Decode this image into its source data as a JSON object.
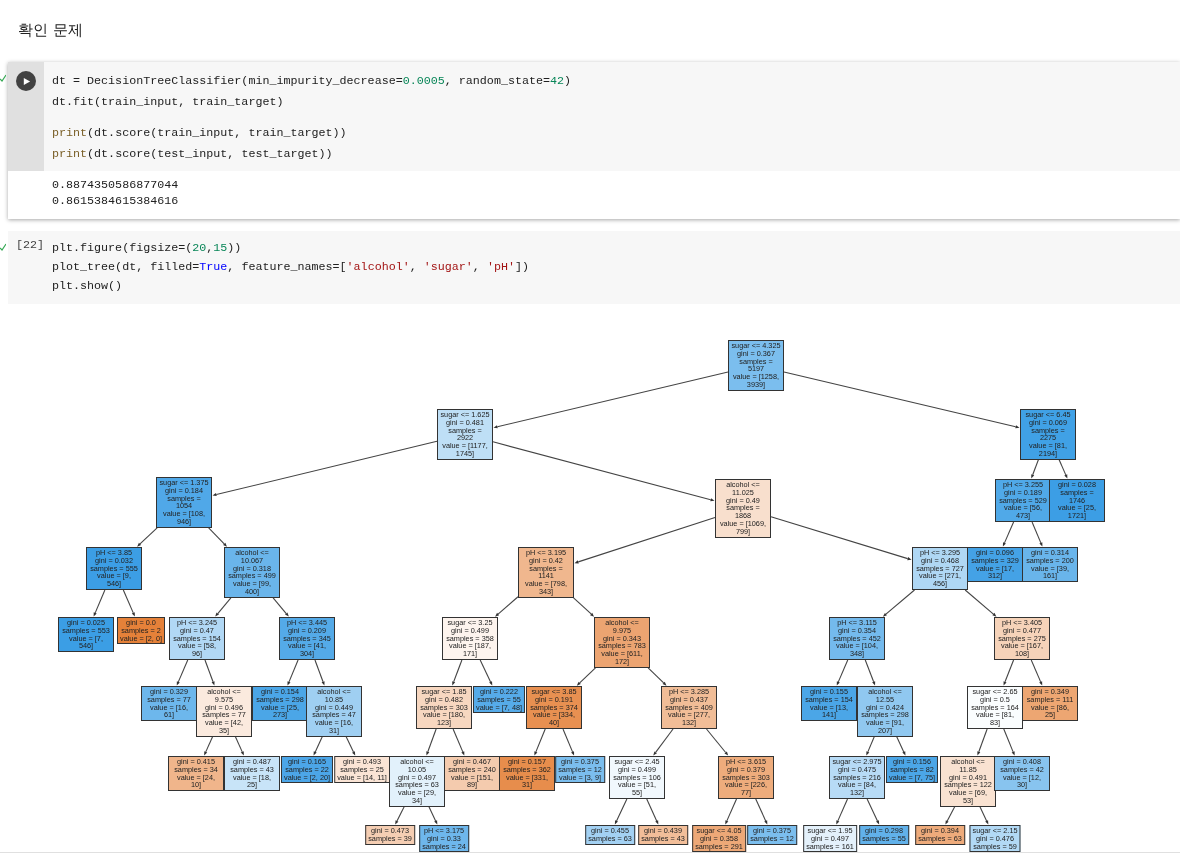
{
  "heading": "확인 문제",
  "cells": [
    {
      "focused": true,
      "completed": true,
      "code": [
        [
          [
            {
              "t": "dt = DecisionTreeClassifier(min_impurity_decrease=",
              "kind": "plain"
            },
            {
              "t": "0.0005",
              "kind": "num"
            },
            {
              "t": ", random_state=",
              "kind": "plain"
            },
            {
              "t": "42",
              "kind": "num"
            },
            {
              "t": ")",
              "kind": "plain"
            }
          ],
          [
            {
              "t": "dt.fit(train_input, train_target)",
              "kind": "plain"
            }
          ]
        ],
        [
          [
            {
              "t": "print",
              "kind": "fn"
            },
            {
              "t": "(dt.score(train_input, train_target))",
              "kind": "plain"
            }
          ],
          [
            {
              "t": "print",
              "kind": "fn"
            },
            {
              "t": "(dt.score(test_input, test_target))",
              "kind": "plain"
            }
          ]
        ]
      ],
      "output": [
        "0.8874350586877044",
        "0.8615384615384616"
      ]
    },
    {
      "focused": false,
      "completed": true,
      "execution_count": "[22]",
      "code": [
        [
          [
            {
              "t": "plt.figure(figsize=(",
              "kind": "plain"
            },
            {
              "t": "20",
              "kind": "num"
            },
            {
              "t": ",",
              "kind": "plain"
            },
            {
              "t": "15",
              "kind": "num"
            },
            {
              "t": "))",
              "kind": "plain"
            }
          ],
          [
            {
              "t": "plot_tree(dt, filled=",
              "kind": "plain"
            },
            {
              "t": "True",
              "kind": "kw"
            },
            {
              "t": ", feature_names=[",
              "kind": "plain"
            },
            {
              "t": "'alcohol'",
              "kind": "str"
            },
            {
              "t": ", ",
              "kind": "plain"
            },
            {
              "t": "'sugar'",
              "kind": "str"
            },
            {
              "t": ", ",
              "kind": "plain"
            },
            {
              "t": "'pH'",
              "kind": "str"
            },
            {
              "t": "])",
              "kind": "plain"
            }
          ],
          [
            {
              "t": "plt.show()",
              "kind": "plain"
            }
          ]
        ]
      ],
      "tree": {
        "lines": [
          "sugar <= 4.325",
          "gini = 0.367",
          "samples = 5197",
          "value = [1258, 3939]"
        ],
        "color": "#7bbeee",
        "children": [
          {
            "lines": [
              "sugar <= 1.625",
              "gini = 0.481",
              "samples = 2922",
              "value = [1177, 1745]"
            ],
            "color": "#bedff6",
            "children": [
              {
                "lines": [
                  "sugar <= 1.375",
                  "gini = 0.184",
                  "samples = 1054",
                  "value = [108, 946]"
                ],
                "color": "#50a8e8",
                "children": [
                  {
                    "lines": [
                      "pH <= 3.85",
                      "gini = 0.032",
                      "samples = 555",
                      "value = [9, 546]"
                    ],
                    "color": "#3c9ee5",
                    "children": [
                      {
                        "lines": [
                          "gini = 0.025",
                          "samples = 553",
                          "value = [7, 546]"
                        ],
                        "color": "#3b9ee5"
                      },
                      {
                        "lines": [
                          "gini = 0.0",
                          "samples = 2",
                          "value = [2, 0]"
                        ],
                        "color": "#e58139"
                      }
                    ]
                  },
                  {
                    "lines": [
                      "alcohol <= 10.067",
                      "gini = 0.318",
                      "samples = 499",
                      "value = [99, 400]"
                    ],
                    "color": "#6ab5eb",
                    "children": [
                      {
                        "lines": [
                          "pH <= 3.245",
                          "gini = 0.47",
                          "samples = 154",
                          "value = [58, 96]"
                        ],
                        "color": "#b1d8f5",
                        "children": [
                          {
                            "lines": [
                              "gini = 0.329",
                              "samples = 77",
                              "value = [16, 61]"
                            ],
                            "color": "#6db7ec"
                          },
                          {
                            "lines": [
                              "alcohol <= 9.575",
                              "gini = 0.496",
                              "samples = 77",
                              "value = [42, 35]"
                            ],
                            "color": "#fbeade",
                            "children": [
                              {
                                "lines": [
                                  "gini = 0.415",
                                  "samples = 34",
                                  "value = [24, 10]"
                                ],
                                "color": "#f0b58b"
                              },
                              {
                                "lines": [
                                  "gini = 0.487",
                                  "samples = 43",
                                  "value = [18, 25]"
                                ],
                                "color": "#c8e4f8"
                              }
                            ]
                          }
                        ]
                      },
                      {
                        "lines": [
                          "pH <= 3.445",
                          "gini = 0.209",
                          "samples = 345",
                          "value = [41, 304]"
                        ],
                        "color": "#54aae8",
                        "children": [
                          {
                            "lines": [
                              "gini = 0.154",
                              "samples = 298",
                              "value = [25, 273]"
                            ],
                            "color": "#4ba6e7"
                          },
                          {
                            "lines": [
                              "alcohol <= 10.85",
                              "gini = 0.449",
                              "samples = 47",
                              "value = [16, 31]"
                            ],
                            "color": "#9fcff2",
                            "children": [
                              {
                                "lines": [
                                  "gini = 0.165",
                                  "samples = 22",
                                  "value = [2, 20]"
                                ],
                                "color": "#4ca6e8"
                              },
                              {
                                "lines": [
                                  "gini = 0.493",
                                  "samples = 25",
                                  "value = [14, 11]"
                                ],
                                "color": "#fae4d5"
                              }
                            ]
                          }
                        ]
                      }
                    ]
                  }
                ]
              },
              {
                "lines": [
                  "alcohol <= 11.025",
                  "gini = 0.49",
                  "samples = 1868",
                  "value = [1069, 799]"
                ],
                "color": "#f8dfcd",
                "children": [
                  {
                    "lines": [
                      "pH <= 3.195",
                      "gini = 0.42",
                      "samples = 1141",
                      "value = [798, 343]"
                    ],
                    "color": "#f0b78e",
                    "children": [
                      {
                        "lines": [
                          "sugar <= 3.25",
                          "gini = 0.499",
                          "samples = 358",
                          "value = [187, 171]"
                        ],
                        "color": "#fdf4ee",
                        "children": [
                          {
                            "lines": [
                              "sugar <= 1.85",
                              "gini = 0.482",
                              "samples = 303",
                              "value = [180, 123]"
                            ],
                            "color": "#f7d7c0",
                            "children": [
                              {
                                "lines": [
                                  "alcohol <= 10.05",
                                  "gini = 0.497",
                                  "samples = 63",
                                  "value = [29, 34]"
                                ],
                                "color": "#e2f1fb",
                                "children": [
                                  {
                                    "lines": [
                                      "gini = 0.473",
                                      "samples = 39"
                                    ],
                                    "color": "#f5ceb3"
                                  },
                                  {
                                    "lines": [
                                      "pH <= 3.175",
                                      "gini = 0.33",
                                      "samples = 24"
                                    ],
                                    "color": "#6eb7ec"
                                  }
                                ]
                              },
                              {
                                "lines": [
                                  "gini = 0.467",
                                  "samples = 240",
                                  "value = [151, 89]"
                                ],
                                "color": "#f4cbae"
                              }
                            ]
                          },
                          {
                            "lines": [
                              "gini = 0.222",
                              "samples = 55",
                              "value = [7, 48]"
                            ],
                            "color": "#56abe9"
                          }
                        ]
                      },
                      {
                        "lines": [
                          "alcohol <= 9.975",
                          "gini = 0.343",
                          "samples = 783",
                          "value = [611, 172]"
                        ],
                        "color": "#eca471",
                        "children": [
                          {
                            "lines": [
                              "sugar <= 3.85",
                              "gini = 0.191",
                              "samples = 374",
                              "value = [334, 40]"
                            ],
                            "color": "#e89051",
                            "children": [
                              {
                                "lines": [
                                  "gini = 0.157",
                                  "samples = 362",
                                  "value = [331, 31]"
                                ],
                                "color": "#e78d4c"
                              },
                              {
                                "lines": [
                                  "gini = 0.375",
                                  "samples = 12",
                                  "value = [3, 9]"
                                ],
                                "color": "#7bbeee"
                              }
                            ]
                          },
                          {
                            "lines": [
                              "pH <= 3.285",
                              "gini = 0.437",
                              "samples = 409",
                              "value = [277, 132]"
                            ],
                            "color": "#f1bd97",
                            "children": [
                              {
                                "lines": [
                                  "sugar <= 2.45",
                                  "gini = 0.499",
                                  "samples = 106",
                                  "value = [51, 55]"
                                ],
                                "color": "#f1f8fd",
                                "children": [
                                  {
                                    "lines": [
                                      "gini = 0.455",
                                      "samples = 63"
                                    ],
                                    "color": "#a3d1f3"
                                  },
                                  {
                                    "lines": [
                                      "gini = 0.439",
                                      "samples = 43"
                                    ],
                                    "color": "#f2be99"
                                  }
                                ]
                              },
                              {
                                "lines": [
                                  "pH <= 3.615",
                                  "gini = 0.379",
                                  "samples = 303",
                                  "value = [226, 77]"
                                ],
                                "color": "#eeac7c",
                                "children": [
                                  {
                                    "lines": [
                                      "sugar <= 4.05",
                                      "gini = 0.358",
                                      "samples = 291"
                                    ],
                                    "color": "#eda877"
                                  },
                                  {
                                    "lines": [
                                      "gini = 0.375",
                                      "samples = 12"
                                    ],
                                    "color": "#7bbeee"
                                  }
                                ]
                              }
                            ]
                          }
                        ]
                      }
                    ]
                  },
                  {
                    "lines": [
                      "pH <= 3.295",
                      "gini = 0.468",
                      "samples = 727",
                      "value = [271, 456]"
                    ],
                    "color": "#afd7f4",
                    "children": [
                      {
                        "lines": [
                          "pH <= 3.115",
                          "gini = 0.354",
                          "samples = 452",
                          "value = [104, 348]"
                        ],
                        "color": "#74baed",
                        "children": [
                          {
                            "lines": [
                              "gini = 0.155",
                              "samples = 154",
                              "value = [13, 141]"
                            ],
                            "color": "#4ba6e7"
                          },
                          {
                            "lines": [
                              "alcohol <= 12.55",
                              "gini = 0.424",
                              "samples = 298",
                              "value = [91, 207]"
                            ],
                            "color": "#90c8f0",
                            "children": [
                              {
                                "lines": [
                                  "sugar <= 2.975",
                                  "gini = 0.475",
                                  "samples = 216",
                                  "value = [84, 132]"
                                ],
                                "color": "#b7dbf6",
                                "children": [
                                  {
                                    "lines": [
                                      "sugar <= 1.95",
                                      "gini = 0.497",
                                      "samples = 161"
                                    ],
                                    "color": "#e4f1fb"
                                  },
                                  {
                                    "lines": [
                                      "gini = 0.298",
                                      "samples = 55"
                                    ],
                                    "color": "#61b1ea"
                                  }
                                ]
                              },
                              {
                                "lines": [
                                  "gini = 0.156",
                                  "samples = 82",
                                  "value = [7, 75]"
                                ],
                                "color": "#4ba6e7"
                              }
                            ]
                          }
                        ]
                      },
                      {
                        "lines": [
                          "pH <= 3.405",
                          "gini = 0.477",
                          "samples = 275",
                          "value = [167, 108]"
                        ],
                        "color": "#f6d3b9",
                        "children": [
                          {
                            "lines": [
                              "sugar <= 2.65",
                              "gini = 0.5",
                              "samples = 164",
                              "value = [81, 83]"
                            ],
                            "color": "#fafdfe",
                            "children": [
                              {
                                "lines": [
                                  "alcohol <= 11.85",
                                  "gini = 0.491",
                                  "samples = 122",
                                  "value = [69, 53]"
                                ],
                                "color": "#f9e2d1",
                                "children": [
                                  {
                                    "lines": [
                                      "gini = 0.394",
                                      "samples = 63"
                                    ],
                                    "color": "#eeab7b"
                                  },
                                  {
                                    "lines": [
                                      "sugar <= 2.15",
                                      "gini = 0.476",
                                      "samples = 59"
                                    ],
                                    "color": "#b2d9f5"
                                  }
                                ]
                              },
                              {
                                "lines": [
                                  "gini = 0.408",
                                  "samples = 42",
                                  "value = [12, 30]"
                                ],
                                "color": "#88c4ef"
                              }
                            ]
                          },
                          {
                            "lines": [
                              "gini = 0.349",
                              "samples = 111",
                              "value = [86, 25]"
                            ],
                            "color": "#eda672"
                          }
                        ]
                      }
                    ]
                  }
                ]
              }
            ]
          },
          {
            "lines": [
              "sugar <= 6.45",
              "gini = 0.069",
              "samples = 2275",
              "value = [81, 2194]"
            ],
            "color": "#40a1e6",
            "children": [
              {
                "lines": [
                  "pH <= 3.255",
                  "gini = 0.189",
                  "samples = 529",
                  "value = [56, 473]"
                ],
                "color": "#50a9e8",
                "children": [
                  {
                    "lines": [
                      "gini = 0.096",
                      "samples = 329",
                      "value = [17, 312]"
                    ],
                    "color": "#44a2e6"
                  },
                  {
                    "lines": [
                      "gini = 0.314",
                      "samples = 200",
                      "value = [39, 161]"
                    ],
                    "color": "#69b5eb"
                  }
                ]
              },
              {
                "lines": [
                  "gini = 0.028",
                  "samples = 1746",
                  "value = [25, 1721]"
                ],
                "color": "#3c9ee5"
              }
            ]
          }
        ]
      }
    }
  ]
}
